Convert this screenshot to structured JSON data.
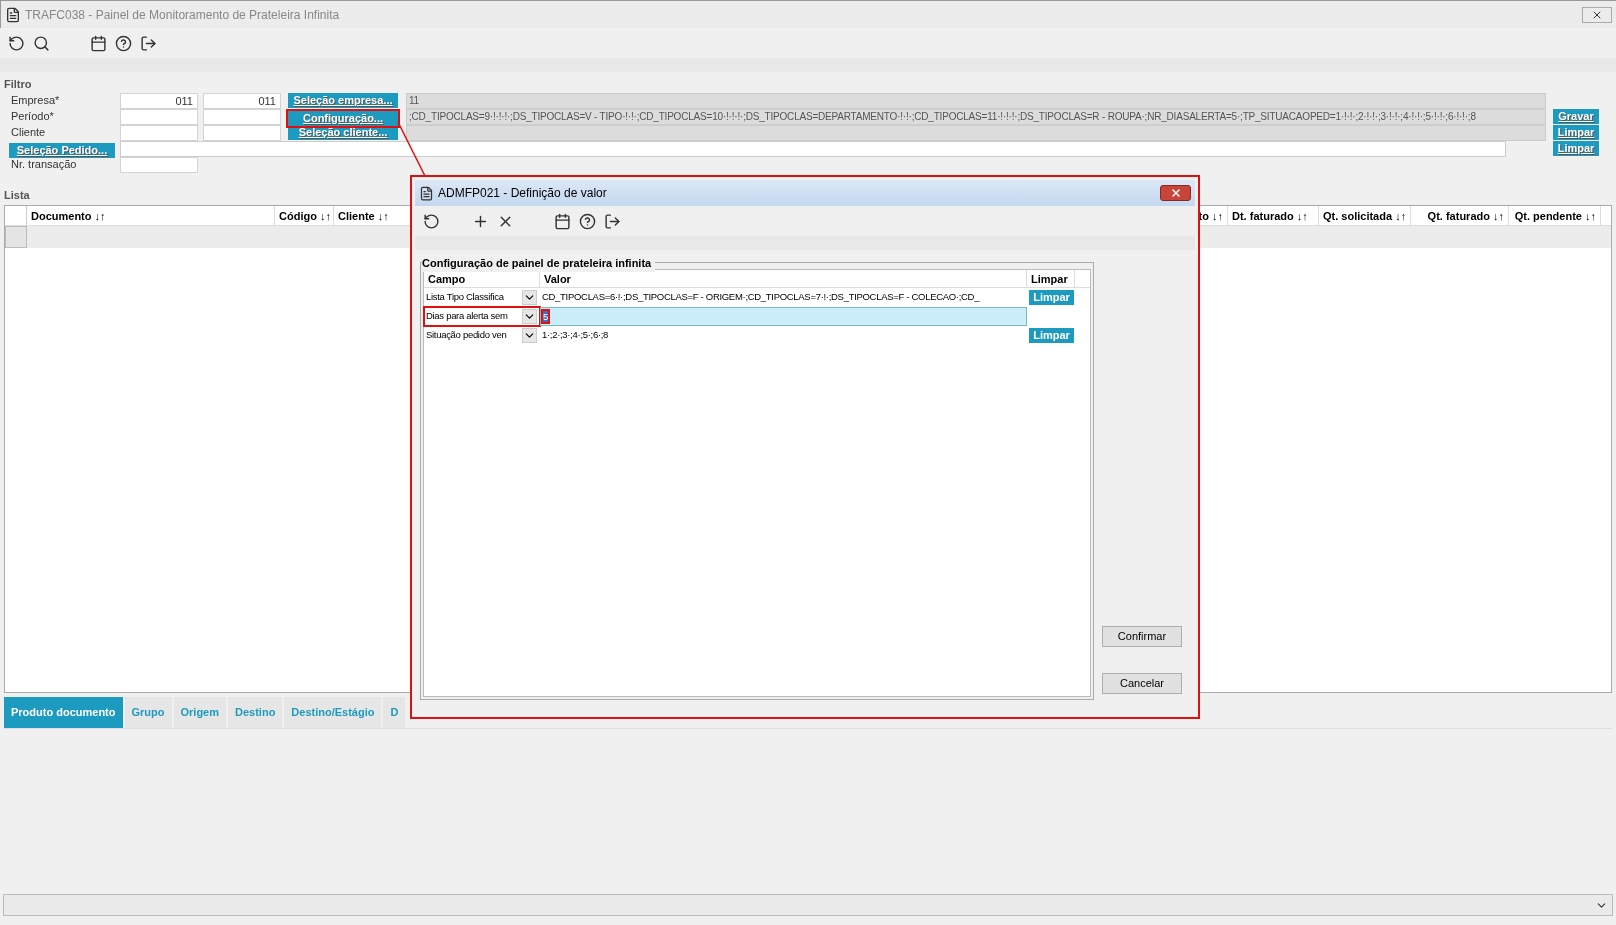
{
  "window": {
    "title": "TRAFC038 - Painel de Monitoramento de Prateleira Infinita"
  },
  "filter": {
    "title": "Filtro",
    "rows": [
      {
        "label": "Empresa*",
        "from": "011",
        "to": "011",
        "button": "Seleção empresa...",
        "value": "11"
      },
      {
        "label": "Período*",
        "value": ";CD_TIPOCLAS=9·!·!·!·;DS_TIPOCLAS=V - TIPO·!·!·;CD_TIPOCLAS=10·!·!·!·;DS_TIPOCLAS=DEPARTAMENTO·!·!·;CD_TIPOCLAS=11·!·!·!·;DS_TIPOCLAS=R - ROUPA·;NR_DIASALERTA=5·;TP_SITUACAOPED=1·!·!·;2·!·!·;3·!·!·;4·!·!·;5·!·!·;6·!·!·;8"
      },
      {
        "label": "Cliente",
        "button": "Seleção cliente..."
      }
    ],
    "config_button": "Configuração...",
    "order_button": "Seleção Pedido...",
    "transaction_label": "Nr. transação",
    "side_buttons": [
      "Gravar",
      "Limpar",
      "Limpar"
    ]
  },
  "list": {
    "title": "Lista",
    "columns": [
      "Documento ↓↑",
      "Código ↓↑",
      "Cliente ↓↑",
      "to ↓↑",
      "Dt. faturado ↓↑",
      "Qt. solicitada ↓↑",
      "Qt. faturado ↓↑",
      "Qt. pendente ↓↑"
    ]
  },
  "tabs": [
    {
      "label": "Produto documento",
      "selected": true
    },
    {
      "label": "Grupo",
      "selected": false
    },
    {
      "label": "Origem",
      "selected": false
    },
    {
      "label": "Destino",
      "selected": false
    },
    {
      "label": "Destino/Estágio",
      "selected": false
    },
    {
      "label": "D",
      "selected": false
    }
  ],
  "dialog": {
    "title": "ADMFP021 - Definição de valor",
    "group": "Configuração de painel de prateleira infinita",
    "columns": [
      "Campo",
      "Valor",
      "Limpar"
    ],
    "rows": [
      {
        "field": "Lista Tipo Classifica",
        "value": "CD_TIPOCLAS=6·!·;DS_TIPOCLAS=F - ORIGEM·;CD_TIPOCLAS=7·!·;DS_TIPOCLAS=F - COLECAO·;CD_",
        "clear": "Limpar",
        "selected": false
      },
      {
        "field": "Dias para alerta sem",
        "value": "5",
        "selected": true
      },
      {
        "field": "Situação pedido ven",
        "value": "1·;2·;3·;4·;5·;6·;8",
        "clear": "Limpar",
        "selected": false
      }
    ],
    "buttons": [
      "Confirmar",
      "Cancelar"
    ]
  }
}
